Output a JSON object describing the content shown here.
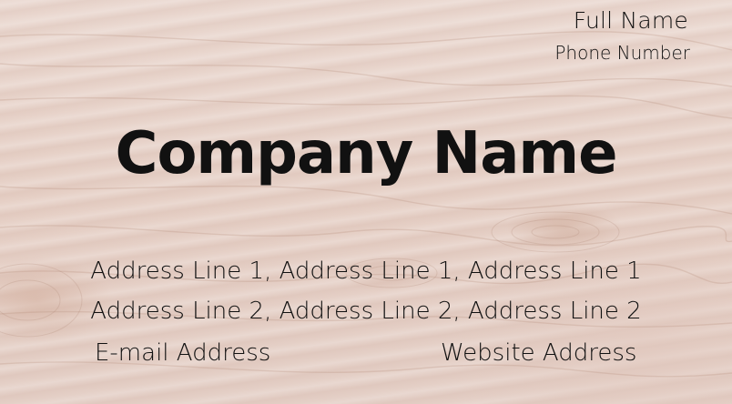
{
  "card": {
    "full_name": "Full Name",
    "phone": "Phone Number",
    "company_name": "Company Name",
    "address_line_1": "Address Line 1, Address Line 1, Address Line 1",
    "address_line_2": "Address Line 2, Address Line 2, Address Line 2",
    "email": "E-mail Address",
    "website": "Website Address"
  },
  "colors": {
    "background": "#e8d4cc",
    "text": "#111111"
  }
}
